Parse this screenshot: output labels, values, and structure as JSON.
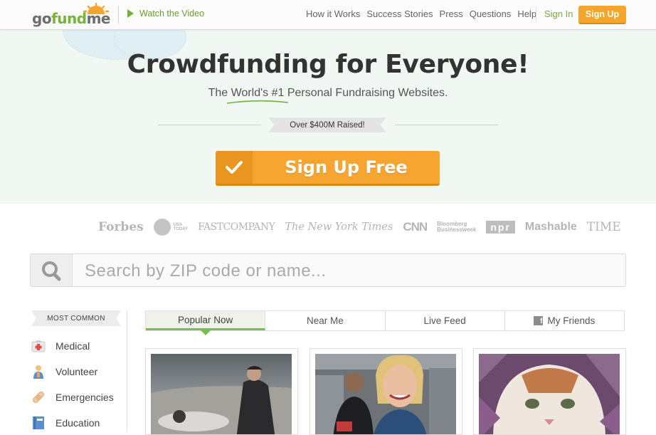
{
  "header": {
    "logo": {
      "go": "go",
      "fund": "fund",
      "me": "me"
    },
    "watch_video": "Watch the Video",
    "nav": [
      "How it Works",
      "Success Stories",
      "Press",
      "Questions",
      "Help"
    ],
    "sign_in": "Sign In",
    "sign_up": "Sign Up"
  },
  "hero": {
    "title": "Crowdfunding for Everyone!",
    "subtitle": "The World's #1 Personal Fundraising Websites.",
    "raised": "Over $400M Raised!",
    "cta": "Sign Up Free"
  },
  "press": {
    "forbes": "Forbes",
    "usa_today_line1": "USA",
    "usa_today_line2": "TODAY",
    "fast_company": "FASTCOMPANY",
    "nyt": "The New York Times",
    "cnn": "CNN",
    "bloomberg_line1": "Bloomberg",
    "bloomberg_line2": "Businessweek",
    "npr": "npr",
    "mashable": "Mashable",
    "time": "TIME"
  },
  "search": {
    "placeholder": "Search by ZIP code or name..."
  },
  "sidebar": {
    "heading": "MOST COMMON",
    "categories": [
      "Medical",
      "Volunteer",
      "Emergencies",
      "Education"
    ]
  },
  "tabs": [
    {
      "label": "Popular Now",
      "active": true
    },
    {
      "label": "Near Me",
      "active": false
    },
    {
      "label": "Live Feed",
      "active": false
    },
    {
      "label": "My Friends",
      "active": false,
      "icon": "facebook-icon"
    }
  ],
  "colors": {
    "brand_green": "#75b43b",
    "brand_orange": "#f5a42c",
    "hero_bg": "#f1f7f2"
  }
}
